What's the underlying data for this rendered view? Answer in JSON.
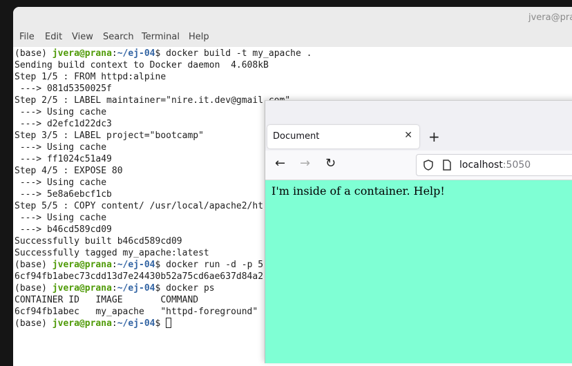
{
  "terminal": {
    "title": "jvera@prana",
    "menu": [
      "File",
      "Edit",
      "View",
      "Search",
      "Terminal",
      "Help"
    ],
    "prompt": {
      "env": "(base) ",
      "user": "jvera@prana",
      "colon": ":",
      "path": "~/ej-04",
      "dollar": "$ "
    },
    "lines": [
      {
        "type": "cmd",
        "text": "docker build -t my_apache ."
      },
      {
        "type": "out",
        "text": "Sending build context to Docker daemon  4.608kB"
      },
      {
        "type": "out",
        "text": "Step 1/5 : FROM httpd:alpine"
      },
      {
        "type": "out",
        "text": " ---> 081d5350025f"
      },
      {
        "type": "out",
        "text": "Step 2/5 : LABEL maintainer=\"nire.it.dev@gmail.com\""
      },
      {
        "type": "out",
        "text": " ---> Using cache"
      },
      {
        "type": "out",
        "text": " ---> d2efc1d22dc3"
      },
      {
        "type": "out",
        "text": "Step 3/5 : LABEL project=\"bootcamp\""
      },
      {
        "type": "out",
        "text": " ---> Using cache"
      },
      {
        "type": "out",
        "text": " ---> ff1024c51a49"
      },
      {
        "type": "out",
        "text": "Step 4/5 : EXPOSE 80"
      },
      {
        "type": "out",
        "text": " ---> Using cache"
      },
      {
        "type": "out",
        "text": " ---> 5e8a6ebcf1cb"
      },
      {
        "type": "out",
        "text": "Step 5/5 : COPY content/ /usr/local/apache2/ht"
      },
      {
        "type": "out",
        "text": " ---> Using cache"
      },
      {
        "type": "out",
        "text": " ---> b46cd589cd09"
      },
      {
        "type": "out",
        "text": "Successfully built b46cd589cd09"
      },
      {
        "type": "out",
        "text": "Successfully tagged my_apache:latest"
      },
      {
        "type": "cmd",
        "text": "docker run -d -p 5"
      },
      {
        "type": "out",
        "text": "6cf94fb1abec73cdd13d7e24430b52a75cd6ae637d84a2"
      },
      {
        "type": "cmd",
        "text": "docker ps"
      },
      {
        "type": "out",
        "text": "CONTAINER ID   IMAGE       COMMAND"
      },
      {
        "type": "out",
        "text": "6cf94fb1abec   my_apache   \"httpd-foreground\""
      },
      {
        "type": "cmd",
        "text": "",
        "cursor": true
      }
    ]
  },
  "browser": {
    "tab_title": "Document",
    "tab_close": "✕",
    "new_tab": "+",
    "back": "←",
    "forward": "→",
    "reload": "↻",
    "url_host": "localhost",
    "url_port": ":5050",
    "page_text": "I'm inside of a container. Help!",
    "page_bg": "#7fffd4"
  }
}
